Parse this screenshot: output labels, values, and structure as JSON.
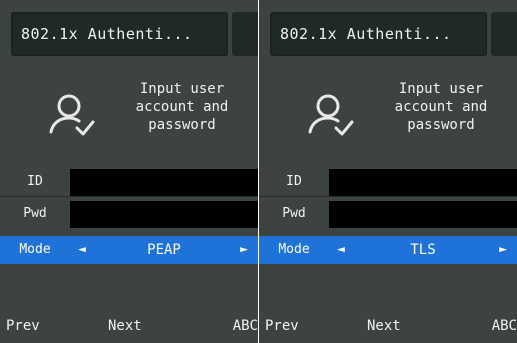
{
  "screens": [
    {
      "title": "802.1x Authenti...",
      "prompt_lines": [
        "Input user",
        "account and",
        "password"
      ],
      "fields": {
        "id_label": "ID",
        "pwd_label": "Pwd",
        "mode_label": "Mode"
      },
      "mode_value": "PEAP",
      "softkeys": {
        "prev": "Prev",
        "next": "Next",
        "abc": "ABC"
      }
    },
    {
      "title": "802.1x Authenti...",
      "prompt_lines": [
        "Input user",
        "account and",
        "password"
      ],
      "fields": {
        "id_label": "ID",
        "pwd_label": "Pwd",
        "mode_label": "Mode"
      },
      "mode_value": "TLS",
      "softkeys": {
        "prev": "Prev",
        "next": "Next",
        "abc": "ABC"
      }
    }
  ],
  "icons": {
    "user": "user-check-icon",
    "left_arrow": "left-arrow-icon",
    "right_arrow": "right-arrow-icon"
  },
  "glyphs": {
    "left_arrow": "◄",
    "right_arrow": "►"
  },
  "colors": {
    "background": "#3d433e",
    "title_bar": "#1f2a27",
    "selected_row": "#1f73d8",
    "field": "#000000",
    "text": "#f2f2f2"
  }
}
